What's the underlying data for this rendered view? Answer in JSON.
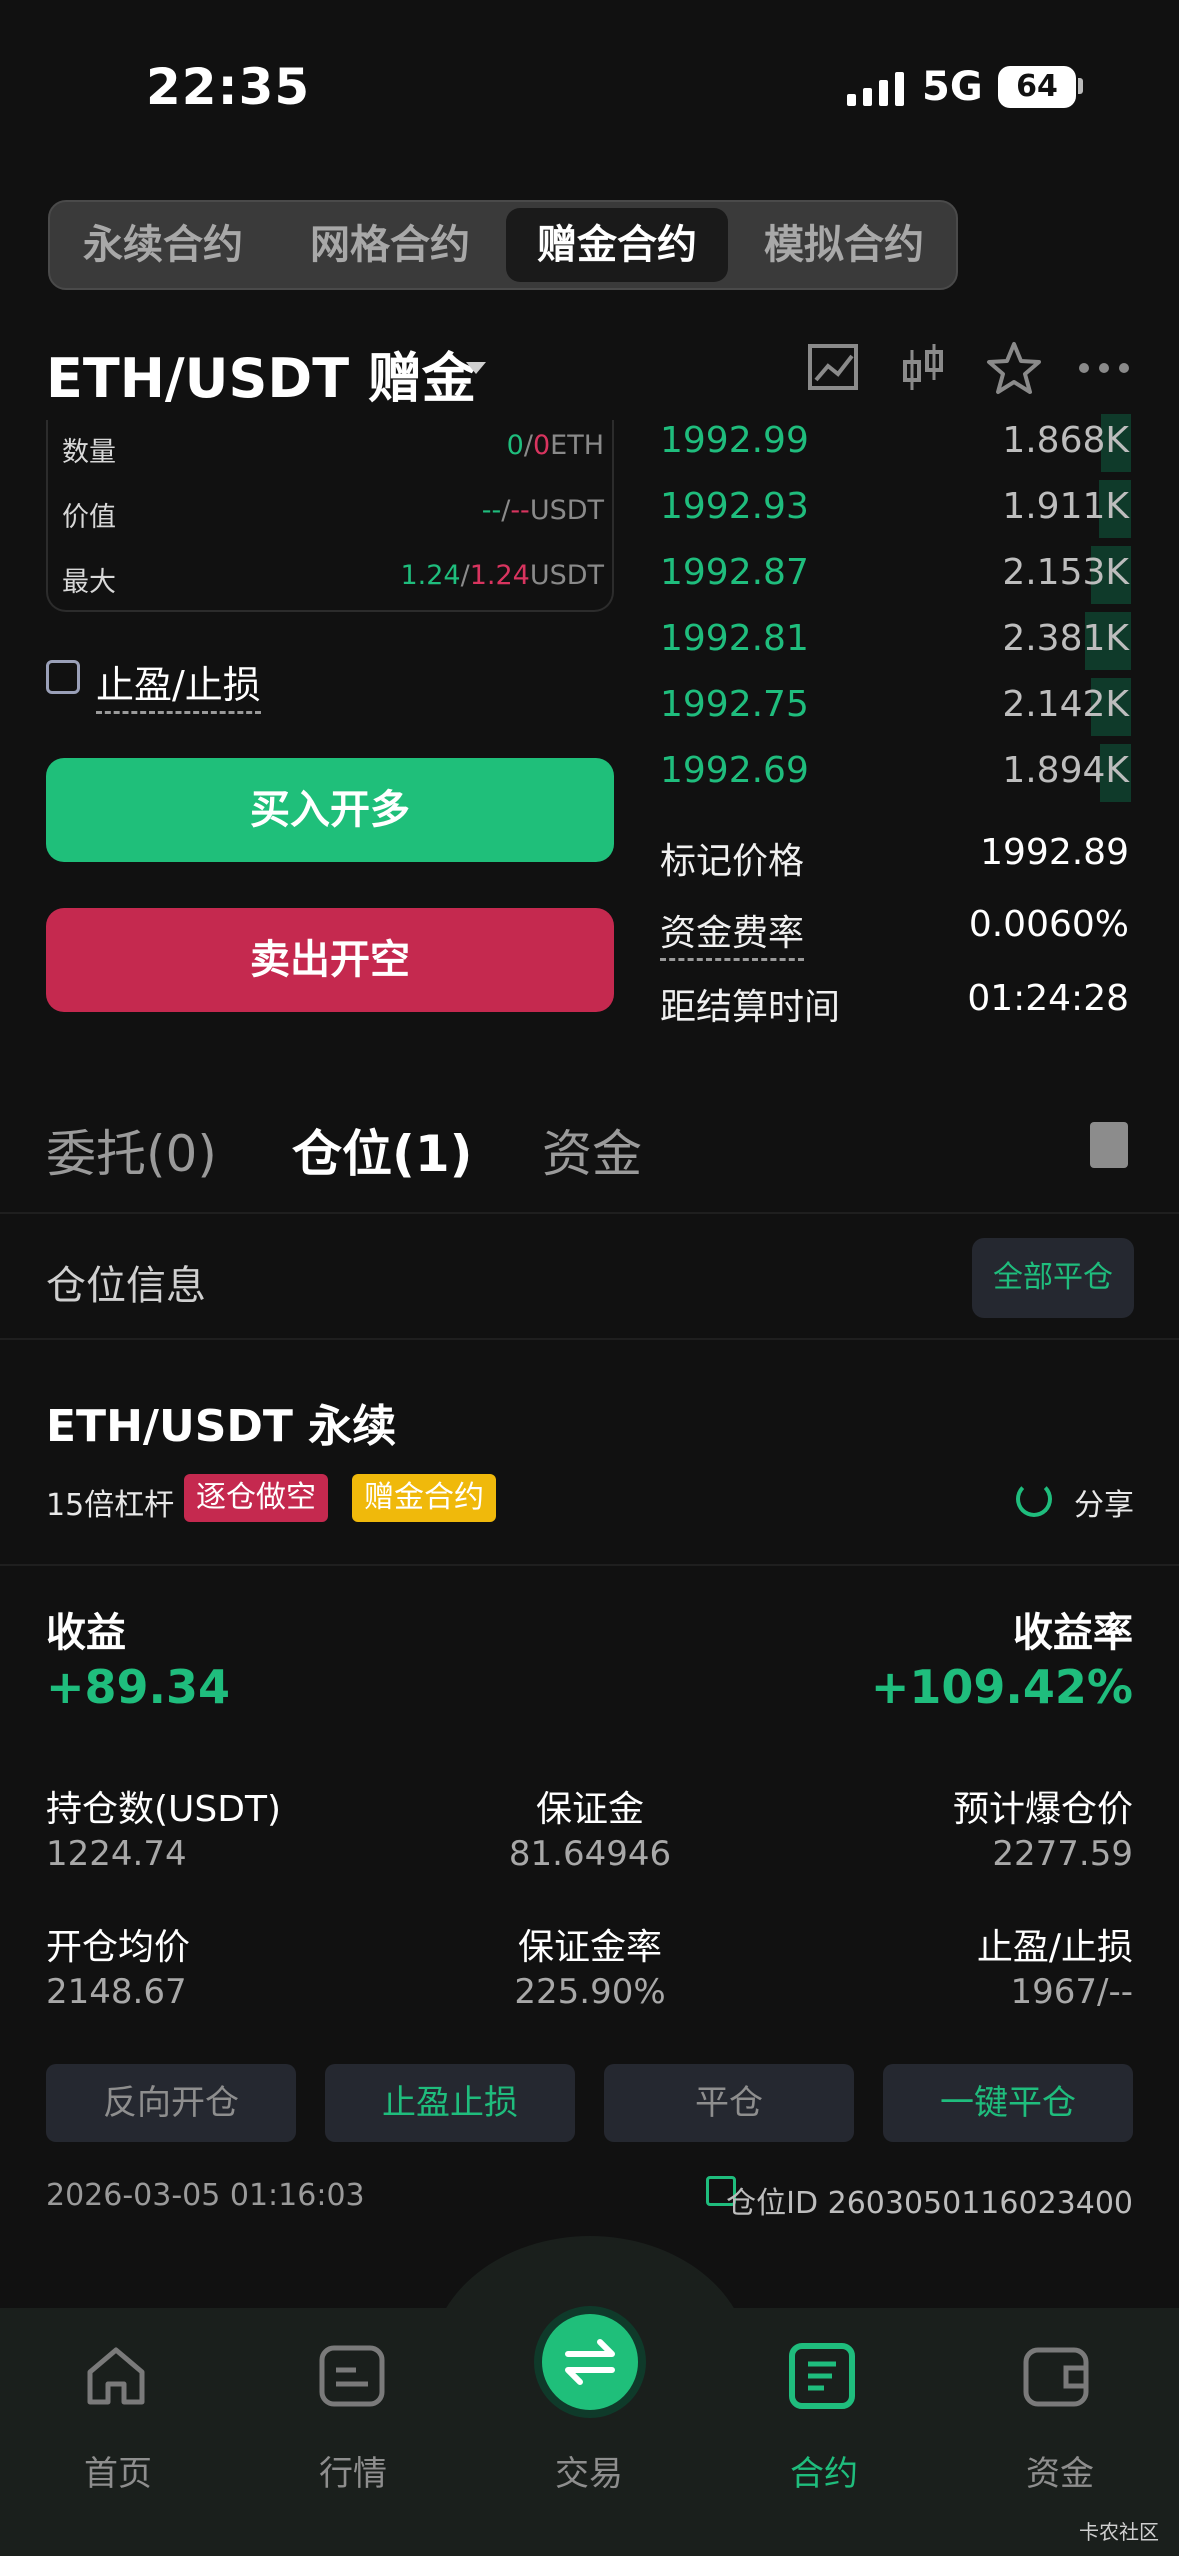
{
  "status": {
    "time": "22:35",
    "network": "5G",
    "battery": "64"
  },
  "segments": [
    "永续合约",
    "网格合约",
    "赠金合约",
    "模拟合约"
  ],
  "segment_active": 2,
  "header": {
    "pair": "ETH/USDT 赠金"
  },
  "order_panel": {
    "rows": [
      {
        "label": "数量",
        "v1": "0",
        "sep": "/",
        "v2": "0",
        "unit": "ETH"
      },
      {
        "label": "价值",
        "v1": "--",
        "sep": "/",
        "v2": "--",
        "unit": "USDT"
      },
      {
        "label": "最大",
        "v1": "1.24",
        "sep": "/",
        "v2": "1.24",
        "unit": "USDT"
      }
    ],
    "tpsl_label": "止盈/止损",
    "buy_label": "买入开多",
    "sell_label": "卖出开空"
  },
  "orderbook": {
    "rows": [
      {
        "price": "1992.99",
        "qty": "1.868K",
        "depth": 0.3
      },
      {
        "price": "1992.93",
        "qty": "1.911K",
        "depth": 0.32
      },
      {
        "price": "1992.87",
        "qty": "2.153K",
        "depth": 0.4
      },
      {
        "price": "1992.81",
        "qty": "2.381K",
        "depth": 0.46
      },
      {
        "price": "1992.75",
        "qty": "2.142K",
        "depth": 0.4
      },
      {
        "price": "1992.69",
        "qty": "1.894K",
        "depth": 0.31
      }
    ],
    "mark_price_label": "标记价格",
    "mark_price": "1992.89",
    "funding_label": "资金费率",
    "funding_rate": "0.0060%",
    "settle_label": "距结算时间",
    "settle_time": "01:24:28"
  },
  "lower_tabs": [
    "委托(0)",
    "仓位(1)",
    "资金"
  ],
  "lower_tab_active": 1,
  "position_info_label": "仓位信息",
  "close_all_label": "全部平仓",
  "position": {
    "title": "ETH/USDT 永续",
    "leverage": "15倍杠杆",
    "tag_mode": "逐仓做空",
    "tag_type": "赠金合约",
    "share_label": "分享",
    "pnl_label": "收益",
    "pnl_value": "+89.34",
    "roe_label": "收益率",
    "roe_value": "+109.42%",
    "stats": [
      {
        "label": "持仓数(USDT)",
        "value": "1224.74"
      },
      {
        "label": "保证金",
        "value": "81.64946"
      },
      {
        "label": "预计爆仓价",
        "value": "2277.59"
      },
      {
        "label": "开仓均价",
        "value": "2148.67"
      },
      {
        "label": "保证金率",
        "value": "225.90%"
      },
      {
        "label": "止盈/止损",
        "value": "1967/--"
      }
    ],
    "actions": [
      "反向开仓",
      "止盈止损",
      "平仓",
      "一键平仓"
    ],
    "timestamp": "2026-03-05 01:16:03",
    "position_id": "仓位ID 2603050116023400"
  },
  "tabbar": [
    "首页",
    "行情",
    "交易",
    "合约",
    "资金"
  ],
  "tabbar_active": 3,
  "watermark": "卡农社区",
  "colors": {
    "green": "#1fbd7d",
    "red": "#c5294f",
    "yellow": "#f0b90b",
    "bg": "#111111"
  }
}
